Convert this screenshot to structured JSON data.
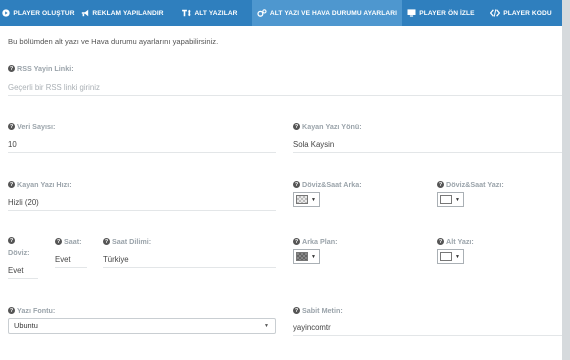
{
  "tabs": [
    {
      "label": "PLAYER OLUŞTUR",
      "icon": "play-circle-icon"
    },
    {
      "label": "REKLAM YAPILANDIR",
      "icon": "bullhorn-icon"
    },
    {
      "label": "ALT YAZILAR",
      "icon": "text-height-icon"
    },
    {
      "label": "ALT YAZI VE HAVA DURUMU AYARLARI",
      "icon": "cogs-icon"
    },
    {
      "label": "PLAYER ÖN İZLE",
      "icon": "monitor-icon"
    },
    {
      "label": "PLAYER KODU",
      "icon": "code-icon"
    }
  ],
  "active_tab": 3,
  "colors": {
    "tabbar": "#2f7fbe",
    "active_tab": "#4e97cf"
  },
  "intro": "Bu bölümden alt yazı ve Hava durumu ayarlarını yapabilirsiniz.",
  "fields": {
    "rss": {
      "label": "RSS Yayin Linki:",
      "placeholder": "Geçerli bir RSS linki giriniz"
    },
    "veri_sayisi": {
      "label": "Veri Sayısı:",
      "value": "10"
    },
    "kayan_yazi_yonu": {
      "label": "Kayan Yazı Yönü:",
      "value": "Sola Kaysin"
    },
    "kayan_yazi_hizi": {
      "label": "Kayan Yazı Hızı:",
      "value": "Hizli (20)"
    },
    "doviz_saat_arka": {
      "label": "Döviz&Saat Arka:"
    },
    "doviz_saat_yazi": {
      "label": "Döviz&Saat Yazı:"
    },
    "doviz": {
      "label": "Döviz:",
      "value": "Evet"
    },
    "saat": {
      "label": "Saat:",
      "value": "Evet"
    },
    "saat_dilimi": {
      "label": "Saat Dilimi:",
      "value": "Türkiye"
    },
    "arka_plan": {
      "label": "Arka Plan:"
    },
    "alt_yazi": {
      "label": "Alt Yazı:"
    },
    "yazi_fontu": {
      "label": "Yazı Fontu:",
      "value": "Ubuntu"
    },
    "sabit_metin": {
      "label": "Sabit Metin:",
      "value": "yayincomtr"
    }
  },
  "help_icon_glyph": "?",
  "caret_glyph": "▼"
}
